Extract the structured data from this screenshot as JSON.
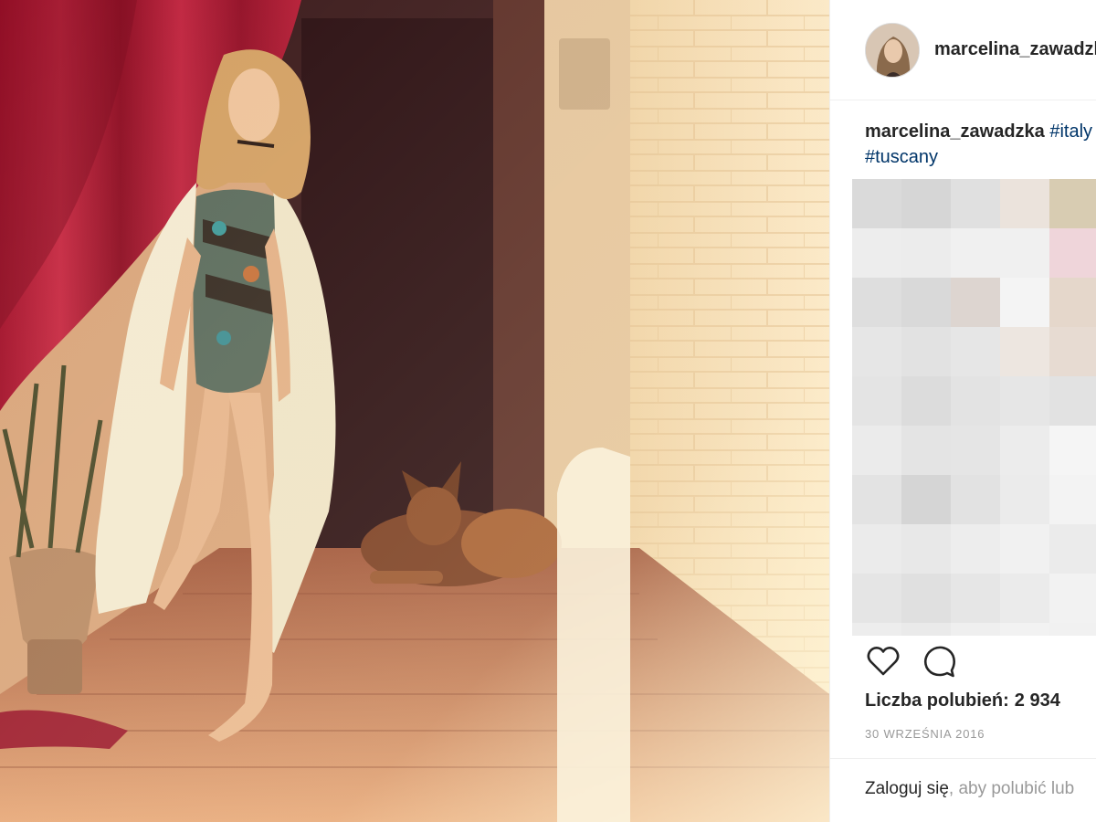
{
  "header": {
    "username": "marcelina_zawadzka"
  },
  "caption": {
    "username": "marcelina_zawadzka",
    "tag_1": "#italy",
    "tag_2": "#tuscany"
  },
  "actions": {
    "like_icon": "heart-icon",
    "comment_icon": "comment-bubble-icon"
  },
  "likes": {
    "label": "Liczba polubień:",
    "count": "2 934"
  },
  "date": "30 WRZEŚNIA 2016",
  "footer": {
    "login_link": "Zaloguj się",
    "rest": ", aby polubić lub"
  },
  "colors": {
    "text_dark": "#262626",
    "text_muted": "#999999",
    "hashtag": "#003569",
    "curtain_red": "#a3122c"
  },
  "pixelated_comments": [
    "#dadada",
    "#d6d6d6",
    "#e0e0e0",
    "#ebe3dc",
    "#d8ccb2",
    "#eeeeee",
    "#ededed",
    "#ececec",
    "#f0f0f0",
    "#f0f0f0",
    "#efd5da",
    "#f2f2f2",
    "#dedede",
    "#d9d9d9",
    "#ddd5d0",
    "#f4f4f4",
    "#e5d7cb",
    "#f0f0f0",
    "#e6e6e6",
    "#e2e2e2",
    "#e6e6e6",
    "#ede6e0",
    "#e7dbd2",
    "#ececec",
    "#e4e4e4",
    "#dcdcdc",
    "#e3e3e3",
    "#e6e6e6",
    "#e2e2e2",
    "#eeeeee",
    "#ebebeb",
    "#e4e4e4",
    "#e5e5e5",
    "#ececec",
    "#f5f5f5",
    "#f0f0f0",
    "#e3e3e3",
    "#d5d5d5",
    "#e2e2e2",
    "#ebebeb",
    "#f3f3f3",
    "#eeeeee",
    "#ebebeb",
    "#e8e8e8",
    "#ededed",
    "#f1f1f1",
    "#ebebeb",
    "#f0f0f0",
    "#e5e5e5",
    "#e0e0e0",
    "#e6e6e6",
    "#ebebeb",
    "#f2f2f2",
    "#eeeeee",
    "#ededed",
    "#eaeaea",
    "#efefef",
    "#f2f2f2",
    "#f1f1f1",
    "#f3f3f3"
  ]
}
